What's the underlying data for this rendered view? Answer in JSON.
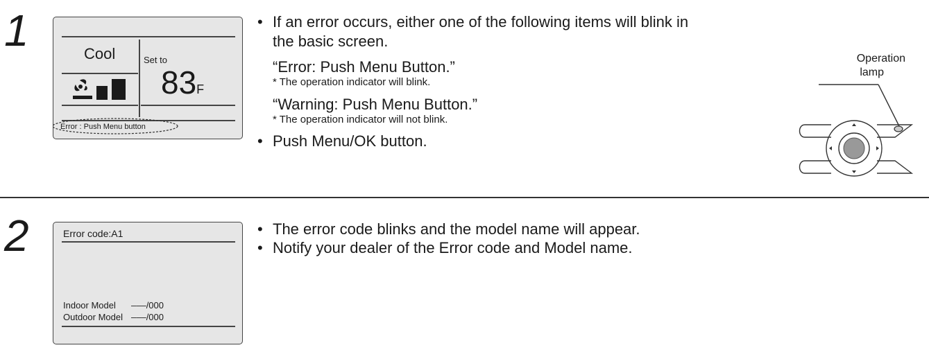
{
  "step1": {
    "number": "1",
    "screen": {
      "mode": "Cool",
      "set_to_label": "Set to",
      "temperature": "83",
      "unit": "F",
      "status_message": "Error : Push Menu button"
    },
    "instructions": {
      "intro_line1": "If an error occurs, either one of the following items will blink in",
      "intro_line2": "the basic screen.",
      "error_msg": "“Error: Push Menu Button.”",
      "error_note": "* The operation indicator will blink.",
      "warning_msg": "“Warning: Push Menu Button.”",
      "warning_note": "* The operation indicator will not blink.",
      "push_button": "Push Menu/OK button."
    },
    "remote": {
      "label_line1": "Operation",
      "label_line2": "lamp"
    }
  },
  "step2": {
    "number": "2",
    "screen": {
      "error_code": "Error code:A1",
      "indoor_label": "Indoor Model",
      "indoor_value": "–––/000",
      "outdoor_label": "Outdoor Model",
      "outdoor_value": "–––/000"
    },
    "instructions": {
      "line1": "The error code blinks and the model name will appear.",
      "line2": "Notify your dealer of the Error code and Model name."
    }
  }
}
